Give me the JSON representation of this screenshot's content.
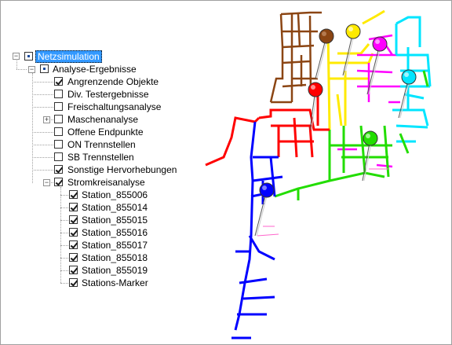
{
  "tree": {
    "root": "Netzsimulation",
    "analyse": "Analyse-Ergebnisse",
    "items": [
      {
        "label": "Angrenzende Objekte",
        "checked": true
      },
      {
        "label": "Div. Testergebnisse",
        "checked": false
      },
      {
        "label": "Freischaltungsanalyse",
        "checked": false
      },
      {
        "label": "Maschenanalyse",
        "checked": false
      },
      {
        "label": "Offene Endpunkte",
        "checked": false
      },
      {
        "label": "ON Trennstellen",
        "checked": false
      },
      {
        "label": "SB Trennstellen",
        "checked": false
      },
      {
        "label": "Sonstige Hervorhebungen",
        "checked": true
      },
      {
        "label": "Stromkreisanalyse",
        "checked": true
      }
    ],
    "stations": [
      {
        "label": "Station_855006",
        "checked": true
      },
      {
        "label": "Station_855014",
        "checked": true
      },
      {
        "label": "Station_855015",
        "checked": true
      },
      {
        "label": "Station_855016",
        "checked": true
      },
      {
        "label": "Station_855017",
        "checked": true
      },
      {
        "label": "Station_855018",
        "checked": true
      },
      {
        "label": "Station_855019",
        "checked": true
      },
      {
        "label": "Stations-Marker",
        "checked": true
      }
    ]
  },
  "map": {
    "colors": {
      "brown": "#8b4513",
      "yellow": "#ffea00",
      "magenta": "#ff00ff",
      "cyan": "#00e5ff",
      "red": "#ff0000",
      "green": "#22dd00",
      "blue": "#0000ff"
    },
    "markers": [
      {
        "name": "station-marker-brown",
        "color": "#8b4513"
      },
      {
        "name": "station-marker-yellow",
        "color": "#ffea00"
      },
      {
        "name": "station-marker-magenta",
        "color": "#ff00ff"
      },
      {
        "name": "station-marker-cyan",
        "color": "#00e5ff"
      },
      {
        "name": "station-marker-red",
        "color": "#ff0000"
      },
      {
        "name": "station-marker-green",
        "color": "#22dd00"
      },
      {
        "name": "station-marker-blue",
        "color": "#0000ff"
      }
    ]
  }
}
